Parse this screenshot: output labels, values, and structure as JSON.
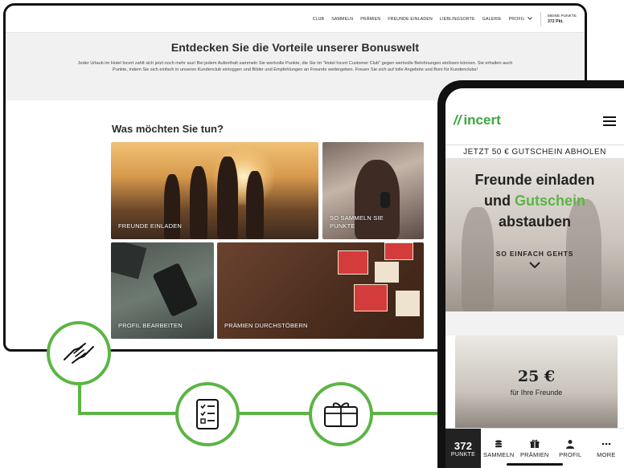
{
  "desktop": {
    "nav": [
      "CLUB",
      "SAMMELN",
      "PRÄMIEN",
      "FREUNDE EINLADEN",
      "LIEBLINGSORTE",
      "GALERIE",
      "PROFIL"
    ],
    "points_label": "MEINE PUNKTE",
    "points_value": "372 Pkt.",
    "headline": "Entdecken Sie die Vorteile unserer Bonuswelt",
    "intro": "Jeder Urlaub im Hotel Incert zahlt sich jetzt noch mehr aus! Bei jedem Aufenthalt sammeln Sie wertvolle Punkte, die Sie im \"Hotel Incert Customer Club\" gegen wertvolle Belohnungen einlösen können. Sie erhalten auch Punkte, indem Sie sich einfach in unseren Kundenclub einloggen und Bilder und Empfehlungen an Freunde weitergeben. Freuen Sie sich auf tolle Angebote und Boni für Kundenclubs!",
    "section_title": "Was möchten Sie tun?",
    "tiles": {
      "friends": "FREUNDE EINLADEN",
      "collect": "SO SAMMELN SIE PUNKTE",
      "profile": "PROFIL BEARBEITEN",
      "rewards": "PRÄMIEN DURCHSTÖBERN"
    }
  },
  "mobile": {
    "brand": "incert",
    "promo": "JETZT 50 € GUTSCHEIN ABHOLEN",
    "hero_line1": "Freunde einladen",
    "hero_line2a": "und",
    "hero_line2b": "Gutschein",
    "hero_line3": "abstauben",
    "cta": "SO EINFACH GEHTS",
    "card_amount": "25 €",
    "card_sub": "für Ihre Freunde",
    "tabbar": {
      "points_value": "372",
      "points_label": "PUNKTE",
      "collect": "SAMMELN",
      "rewards": "PRÄMIEN",
      "profile": "PROFIL",
      "more": "MORE"
    }
  },
  "colors": {
    "accent": "#5bb544",
    "dark": "#111111"
  },
  "icons": [
    "handshake-icon",
    "checklist-icon",
    "gift-card-icon",
    "menu-icon",
    "chevron-down-icon",
    "coins-icon",
    "gift-icon",
    "user-icon",
    "more-icon"
  ]
}
